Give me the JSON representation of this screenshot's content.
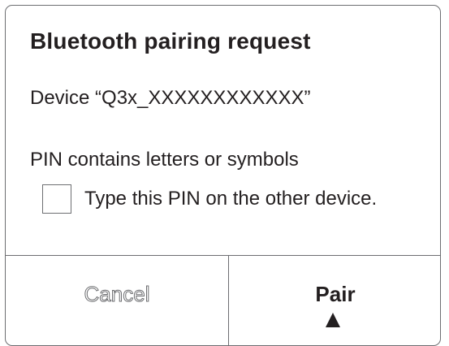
{
  "dialog": {
    "title": "Bluetooth pairing request",
    "device_line": "Device “Q3x_XXXXXXXXXXXX”",
    "pin_note": "PIN contains letters or symbols",
    "checkbox": {
      "label": "Type this PIN on the other device.",
      "checked": false
    }
  },
  "buttons": {
    "cancel_label": "Cancel",
    "pair_label": "Pair"
  },
  "colors": {
    "text": "#231f20",
    "border": "#6d6e71",
    "background": "#ffffff"
  },
  "icons": {
    "pointer": "up-triangle"
  }
}
